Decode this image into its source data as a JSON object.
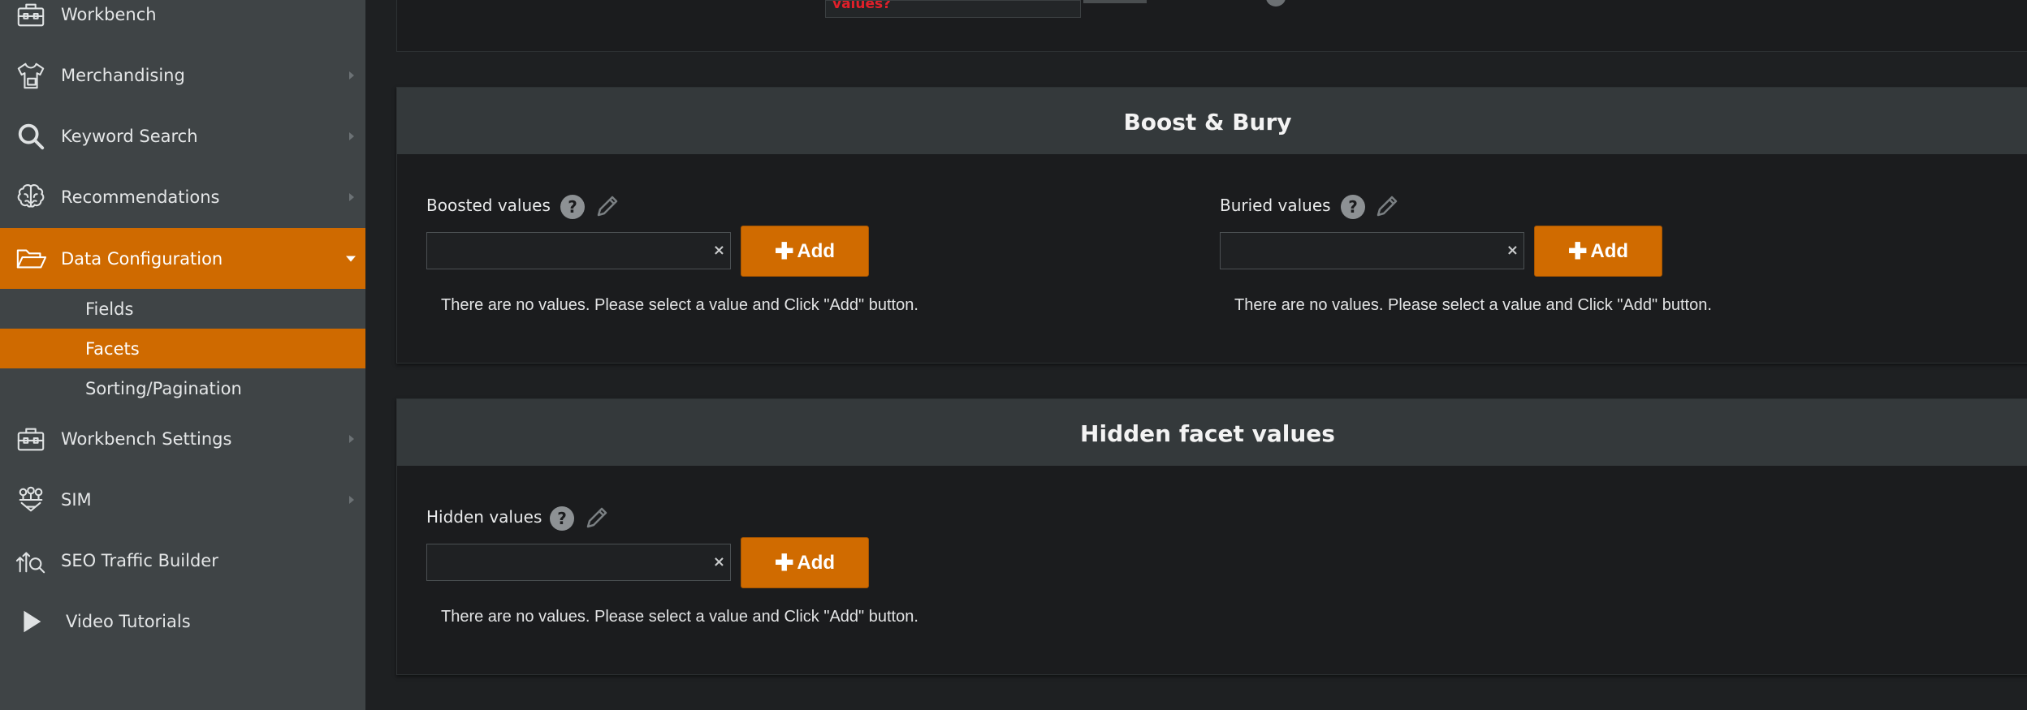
{
  "sidebar": {
    "items": [
      {
        "label": "Workbench",
        "icon": "toolbox-icon"
      },
      {
        "label": "Merchandising",
        "icon": "shirt-icon"
      },
      {
        "label": "Keyword Search",
        "icon": "search-icon"
      },
      {
        "label": "Recommendations",
        "icon": "brain-icon"
      },
      {
        "label": "Data Configuration",
        "icon": "folder-open-icon"
      },
      {
        "label": "Workbench Settings",
        "icon": "toolbox-icon"
      },
      {
        "label": "SIM",
        "icon": "sim-icon"
      },
      {
        "label": "SEO Traffic Builder",
        "icon": "seo-icon"
      },
      {
        "label": "Video Tutorials",
        "icon": "play-icon"
      }
    ],
    "subitems": [
      {
        "label": "Fields"
      },
      {
        "label": "Facets"
      },
      {
        "label": "Sorting/Pagination"
      }
    ],
    "active_item": "Data Configuration",
    "active_subitem": "Facets"
  },
  "top_strip": {
    "field_text": "values?"
  },
  "boost_bury": {
    "title": "Boost & Bury",
    "boosted": {
      "label": "Boosted values",
      "add_label": "Add",
      "empty_message": "There are no values. Please select a value and Click \"Add\" button."
    },
    "buried": {
      "label": "Buried values",
      "add_label": "Add",
      "empty_message": "There are no values. Please select a value and Click \"Add\" button."
    }
  },
  "hidden": {
    "title": "Hidden facet values",
    "hidden_values": {
      "label": "Hidden values",
      "add_label": "Add",
      "empty_message": "There are no values. Please select a value and Click \"Add\" button."
    }
  },
  "common": {
    "help_glyph": "?",
    "clear_glyph": "×",
    "plus_glyph": "✚"
  },
  "colors": {
    "accent": "#cf6a00",
    "sidebar_bg": "#3f4446",
    "main_bg": "#1e2022",
    "panel_header_bg": "#34393b",
    "warning_text": "#e0202a"
  }
}
